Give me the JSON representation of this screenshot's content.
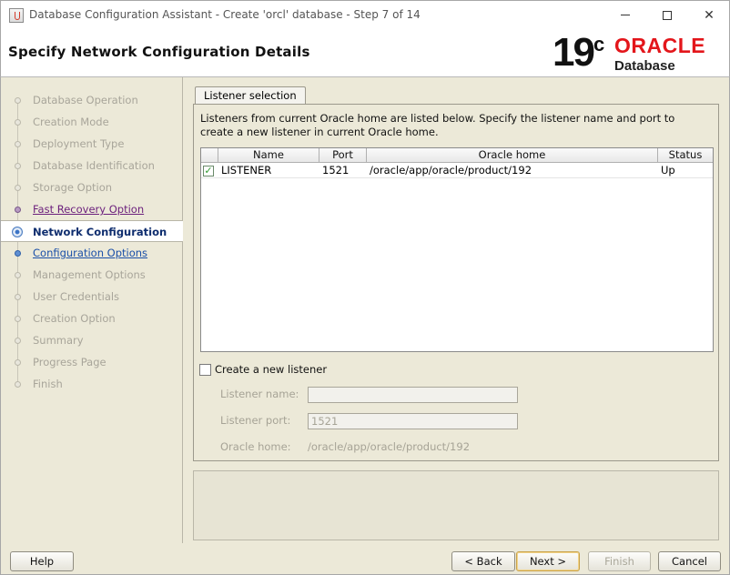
{
  "window": {
    "title": "Database Configuration Assistant - Create 'orcl' database - Step 7 of 14"
  },
  "header": {
    "page_title": "Specify Network Configuration Details",
    "logo_version": "19",
    "logo_version_sup": "c",
    "logo_brand": "ORACLE",
    "logo_product": "Database"
  },
  "steps": [
    {
      "label": "Database Operation",
      "state": "done"
    },
    {
      "label": "Creation Mode",
      "state": "done"
    },
    {
      "label": "Deployment Type",
      "state": "done"
    },
    {
      "label": "Database Identification",
      "state": "done"
    },
    {
      "label": "Storage Option",
      "state": "done"
    },
    {
      "label": "Fast Recovery Option",
      "state": "visited"
    },
    {
      "label": "Network Configuration",
      "state": "current"
    },
    {
      "label": "Configuration Options",
      "state": "next"
    },
    {
      "label": "Management Options",
      "state": "disabled"
    },
    {
      "label": "User Credentials",
      "state": "disabled"
    },
    {
      "label": "Creation Option",
      "state": "disabled"
    },
    {
      "label": "Summary",
      "state": "disabled"
    },
    {
      "label": "Progress Page",
      "state": "disabled"
    },
    {
      "label": "Finish",
      "state": "disabled"
    }
  ],
  "tab": {
    "label": "Listener selection"
  },
  "listener_panel": {
    "description": "Listeners from current Oracle home are listed below. Specify the listener name and port to create a new listener in current Oracle home.",
    "columns": [
      "Name",
      "Port",
      "Oracle home",
      "Status"
    ],
    "rows": [
      {
        "checked": true,
        "name": "LISTENER",
        "port": "1521",
        "oracle_home": "/oracle/app/oracle/product/192",
        "status": "Up"
      }
    ]
  },
  "new_listener": {
    "checkbox_label": "Create a new listener",
    "checked": false,
    "name_label": "Listener name:",
    "name_value": "",
    "port_label": "Listener port:",
    "port_value": "1521",
    "home_label": "Oracle home:",
    "home_value": "/oracle/app/oracle/product/192"
  },
  "buttons": {
    "help": "Help",
    "back": "< Back",
    "next": "Next >",
    "finish": "Finish",
    "cancel": "Cancel"
  },
  "colors": {
    "background": "#ece9d8",
    "oracle_red": "#e3161b",
    "current_step_text": "#0e2d6e",
    "visited_link": "#6b1f7c",
    "next_link": "#1a4fa8",
    "disabled_text": "#a8a59a"
  }
}
